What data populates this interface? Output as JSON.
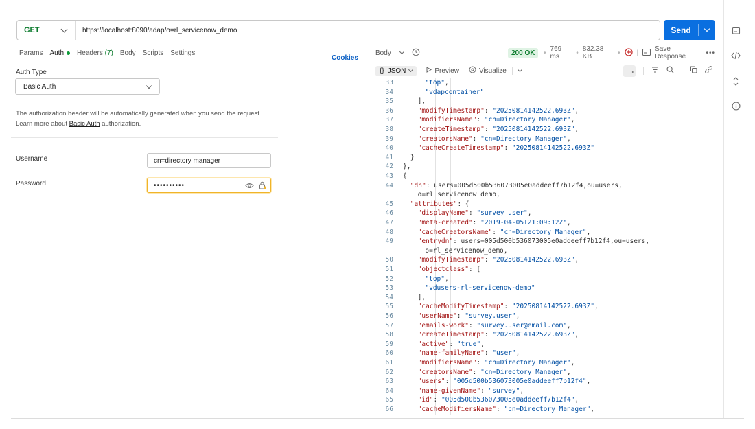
{
  "request": {
    "method": "GET",
    "url": "https://localhost:8090/adap/o=rl_servicenow_demo",
    "send_label": "Send"
  },
  "request_tabs": {
    "params": "Params",
    "auth": "Auth",
    "headers": "Headers",
    "headers_count": "(7)",
    "body": "Body",
    "scripts": "Scripts",
    "settings": "Settings",
    "cookies": "Cookies"
  },
  "auth": {
    "type_label": "Auth Type",
    "type_value": "Basic Auth",
    "desc_line1": "The authorization header will be automatically generated when you send the request.",
    "desc_prefix": "Learn more about ",
    "desc_link": "Basic Auth",
    "desc_suffix": " authorization.",
    "username_label": "Username",
    "username_value": "cn=directory manager",
    "password_label": "Password",
    "password_value": "••••••••••"
  },
  "response": {
    "body_label": "Body",
    "status": "200 OK",
    "time": "769 ms",
    "size": "832.38 KB",
    "save_label": "Save Response",
    "format_label": "JSON",
    "preview_label": "Preview",
    "visualize_label": "Visualize"
  },
  "icons": {
    "history": "history-icon",
    "network": "network-icon",
    "save": "save-icon",
    "more": "more-icon",
    "wrap": "wrap-icon",
    "filter": "filter-icon",
    "search": "search-icon",
    "copy": "copy-icon",
    "link": "link-icon",
    "eye": "eye-icon",
    "lock": "lock-icon",
    "rail": [
      "comment-icon",
      "code-icon",
      "expand-icon",
      "info-icon"
    ]
  },
  "colors": {
    "accent": "#0a6fe0",
    "method": "#0e7c2f",
    "status_bg": "#dff3e4",
    "key": "#a31515",
    "string": "#0451a5"
  },
  "code_lines": [
    {
      "n": "33",
      "i": 8,
      "t": "\"top\","
    },
    {
      "n": "34",
      "i": 8,
      "t": "\"vdapcontainer\""
    },
    {
      "n": "35",
      "i": 7,
      "t": "],"
    },
    {
      "n": "36",
      "i": 7,
      "t": "\"modifyTimestamp\": \"20250814142522.693Z\","
    },
    {
      "n": "37",
      "i": 7,
      "t": "\"modifiersName\": \"cn=Directory Manager\","
    },
    {
      "n": "38",
      "i": 7,
      "t": "\"createTimestamp\": \"20250814142522.693Z\","
    },
    {
      "n": "39",
      "i": 7,
      "t": "\"creatorsName\": \"cn=Directory Manager\","
    },
    {
      "n": "40",
      "i": 7,
      "t": "\"cacheCreateTimestamp\": \"20250814142522.693Z\""
    },
    {
      "n": "41",
      "i": 6,
      "t": "}"
    },
    {
      "n": "42",
      "i": 5,
      "t": "},"
    },
    {
      "n": "43",
      "i": 5,
      "t": "{"
    },
    {
      "n": "44",
      "i": 6,
      "t": "\"dn\": \"users=005d500b536073005e0addeeff7b12f4,ou=users,"
    },
    {
      "n": "",
      "i": 7,
      "t": "o=rl_servicenow_demo\","
    },
    {
      "n": "45",
      "i": 6,
      "t": "\"attributes\": {"
    },
    {
      "n": "46",
      "i": 7,
      "t": "\"displayName\": \"survey user\","
    },
    {
      "n": "47",
      "i": 7,
      "t": "\"meta-created\": \"2019-04-05T21:09:12Z\","
    },
    {
      "n": "48",
      "i": 7,
      "t": "\"cacheCreatorsName\": \"cn=Directory Manager\","
    },
    {
      "n": "49",
      "i": 7,
      "t": "\"entrydn\": \"users=005d500b536073005e0addeeff7b12f4,ou=users,"
    },
    {
      "n": "",
      "i": 8,
      "t": "o=rl_servicenow_demo\","
    },
    {
      "n": "50",
      "i": 7,
      "t": "\"modifyTimestamp\": \"20250814142522.693Z\","
    },
    {
      "n": "51",
      "i": 7,
      "t": "\"objectclass\": ["
    },
    {
      "n": "52",
      "i": 8,
      "t": "\"top\","
    },
    {
      "n": "53",
      "i": 8,
      "t": "\"vdusers-rl-servicenow-demo\""
    },
    {
      "n": "54",
      "i": 7,
      "t": "],"
    },
    {
      "n": "55",
      "i": 7,
      "t": "\"cacheModifyTimestamp\": \"20250814142522.693Z\","
    },
    {
      "n": "56",
      "i": 7,
      "t": "\"userName\": \"survey.user\","
    },
    {
      "n": "57",
      "i": 7,
      "t": "\"emails-work\": \"survey.user@email.com\","
    },
    {
      "n": "58",
      "i": 7,
      "t": "\"createTimestamp\": \"20250814142522.693Z\","
    },
    {
      "n": "59",
      "i": 7,
      "t": "\"active\": \"true\","
    },
    {
      "n": "60",
      "i": 7,
      "t": "\"name-familyName\": \"user\","
    },
    {
      "n": "61",
      "i": 7,
      "t": "\"modifiersName\": \"cn=Directory Manager\","
    },
    {
      "n": "62",
      "i": 7,
      "t": "\"creatorsName\": \"cn=Directory Manager\","
    },
    {
      "n": "63",
      "i": 7,
      "t": "\"users\": \"005d500b536073005e0addeeff7b12f4\","
    },
    {
      "n": "64",
      "i": 7,
      "t": "\"name-givenName\": \"survey\","
    },
    {
      "n": "65",
      "i": 7,
      "t": "\"id\": \"005d500b536073005e0addeeff7b12f4\","
    },
    {
      "n": "66",
      "i": 7,
      "t": "\"cacheModifiersName\": \"cn=Directory Manager\","
    }
  ]
}
